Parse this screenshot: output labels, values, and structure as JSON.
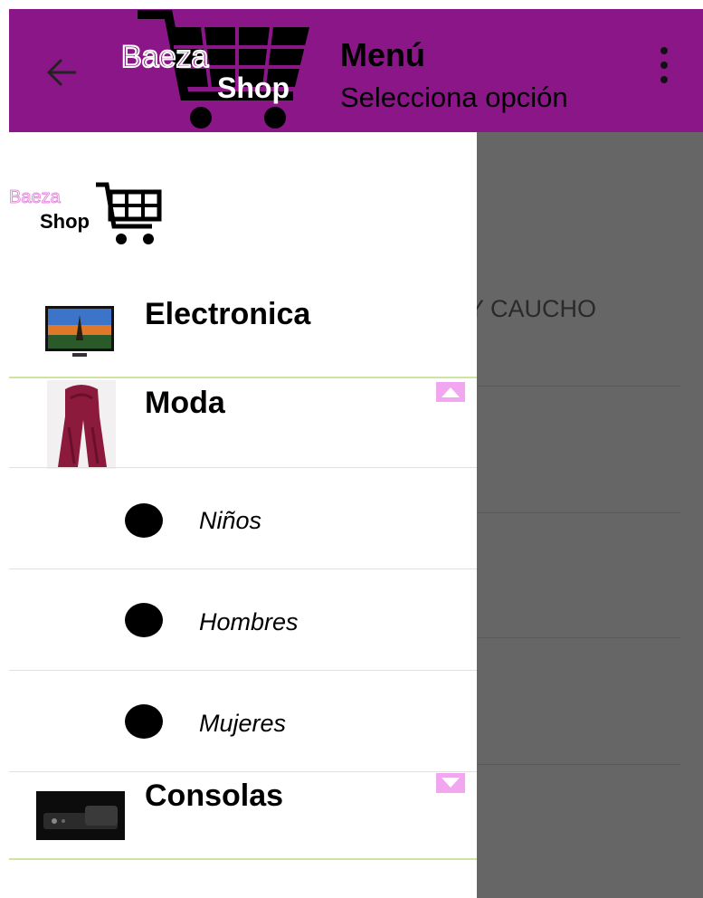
{
  "appbar": {
    "title": "Menú",
    "subtitle": "Selecciona opción",
    "logo_word_top": "Baeza",
    "logo_word_bottom": "Shop",
    "color": "#8b1688"
  },
  "drawer_logo": {
    "word_top": "Baeza",
    "word_bottom": "Shop"
  },
  "background": {
    "visible_text": "Y CAUCHO"
  },
  "categories": [
    {
      "label": "Electronica"
    },
    {
      "label": "Moda"
    },
    {
      "label": "Consolas"
    }
  ],
  "moda_subitems": [
    {
      "label": "Niños"
    },
    {
      "label": "Hombres"
    },
    {
      "label": "Mujeres"
    }
  ],
  "colors": {
    "accent": "#8b1688",
    "toggle": "#f3a6f0",
    "divider": "#cfe3a3",
    "scrim": "#666666"
  }
}
